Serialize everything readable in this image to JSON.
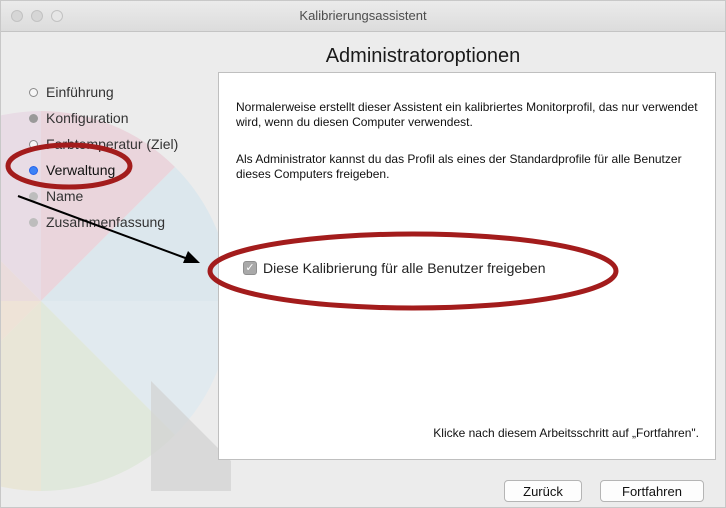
{
  "window": {
    "title": "Kalibrierungsassistent"
  },
  "page": {
    "title": "Administratoroptionen"
  },
  "sidebar": {
    "steps": [
      {
        "label": "Einführung",
        "state": "done"
      },
      {
        "label": "Konfiguration",
        "state": "done"
      },
      {
        "label": "Farbtemperatur (Ziel)",
        "state": "done"
      },
      {
        "label": "Verwaltung",
        "state": "current"
      },
      {
        "label": "Name",
        "state": "pending"
      },
      {
        "label": "Zusammenfassung",
        "state": "pending"
      }
    ]
  },
  "content": {
    "paragraph1": "Normalerweise erstellt dieser Assistent ein kalibriertes Monitorprofil, das nur verwendet wird, wenn du diesen Computer verwendest.",
    "paragraph2": "Als Administrator kannst du das Profil als eines der Standardprofile für alle Benutzer dieses Computers freigeben.",
    "checkbox_label": "Diese Kalibrierung für alle Benutzer freigeben",
    "checkbox_checked": true,
    "checkbox_glyph": "✓",
    "hint": "Klicke nach diesem Arbeitsschritt auf „Fortfahren\"."
  },
  "buttons": {
    "back": "Zurück",
    "continue": "Fortfahren"
  },
  "colors": {
    "accent": "#3b82f6",
    "annotation": "#a31c1c"
  }
}
